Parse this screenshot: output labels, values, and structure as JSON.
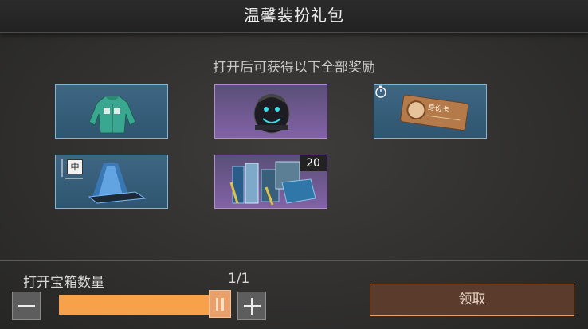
{
  "header": {
    "title": "温馨装扮礼包"
  },
  "rewards": {
    "subtitle": "打开后可获得以下全部奖励",
    "items": [
      {
        "name": "hoodie",
        "rarity": "blue"
      },
      {
        "name": "backpack",
        "rarity": "purple"
      },
      {
        "name": "name-card",
        "rarity": "blue",
        "badge": "timer-icon",
        "card_text": "身份卡"
      },
      {
        "name": "glowing-trail",
        "rarity": "blue",
        "size_tag": "中"
      },
      {
        "name": "material-bundle",
        "rarity": "purple",
        "count": "20"
      }
    ]
  },
  "quantity": {
    "label": "打开宝箱数量",
    "value": "1/1",
    "fill_fraction": 1.0
  },
  "claim_button": {
    "label": "领取"
  },
  "colors": {
    "blue_frame": "#7fb6d6",
    "purple_frame": "#b28ad6",
    "slider": "#f7a24b",
    "claim_border": "#e8a26d"
  }
}
